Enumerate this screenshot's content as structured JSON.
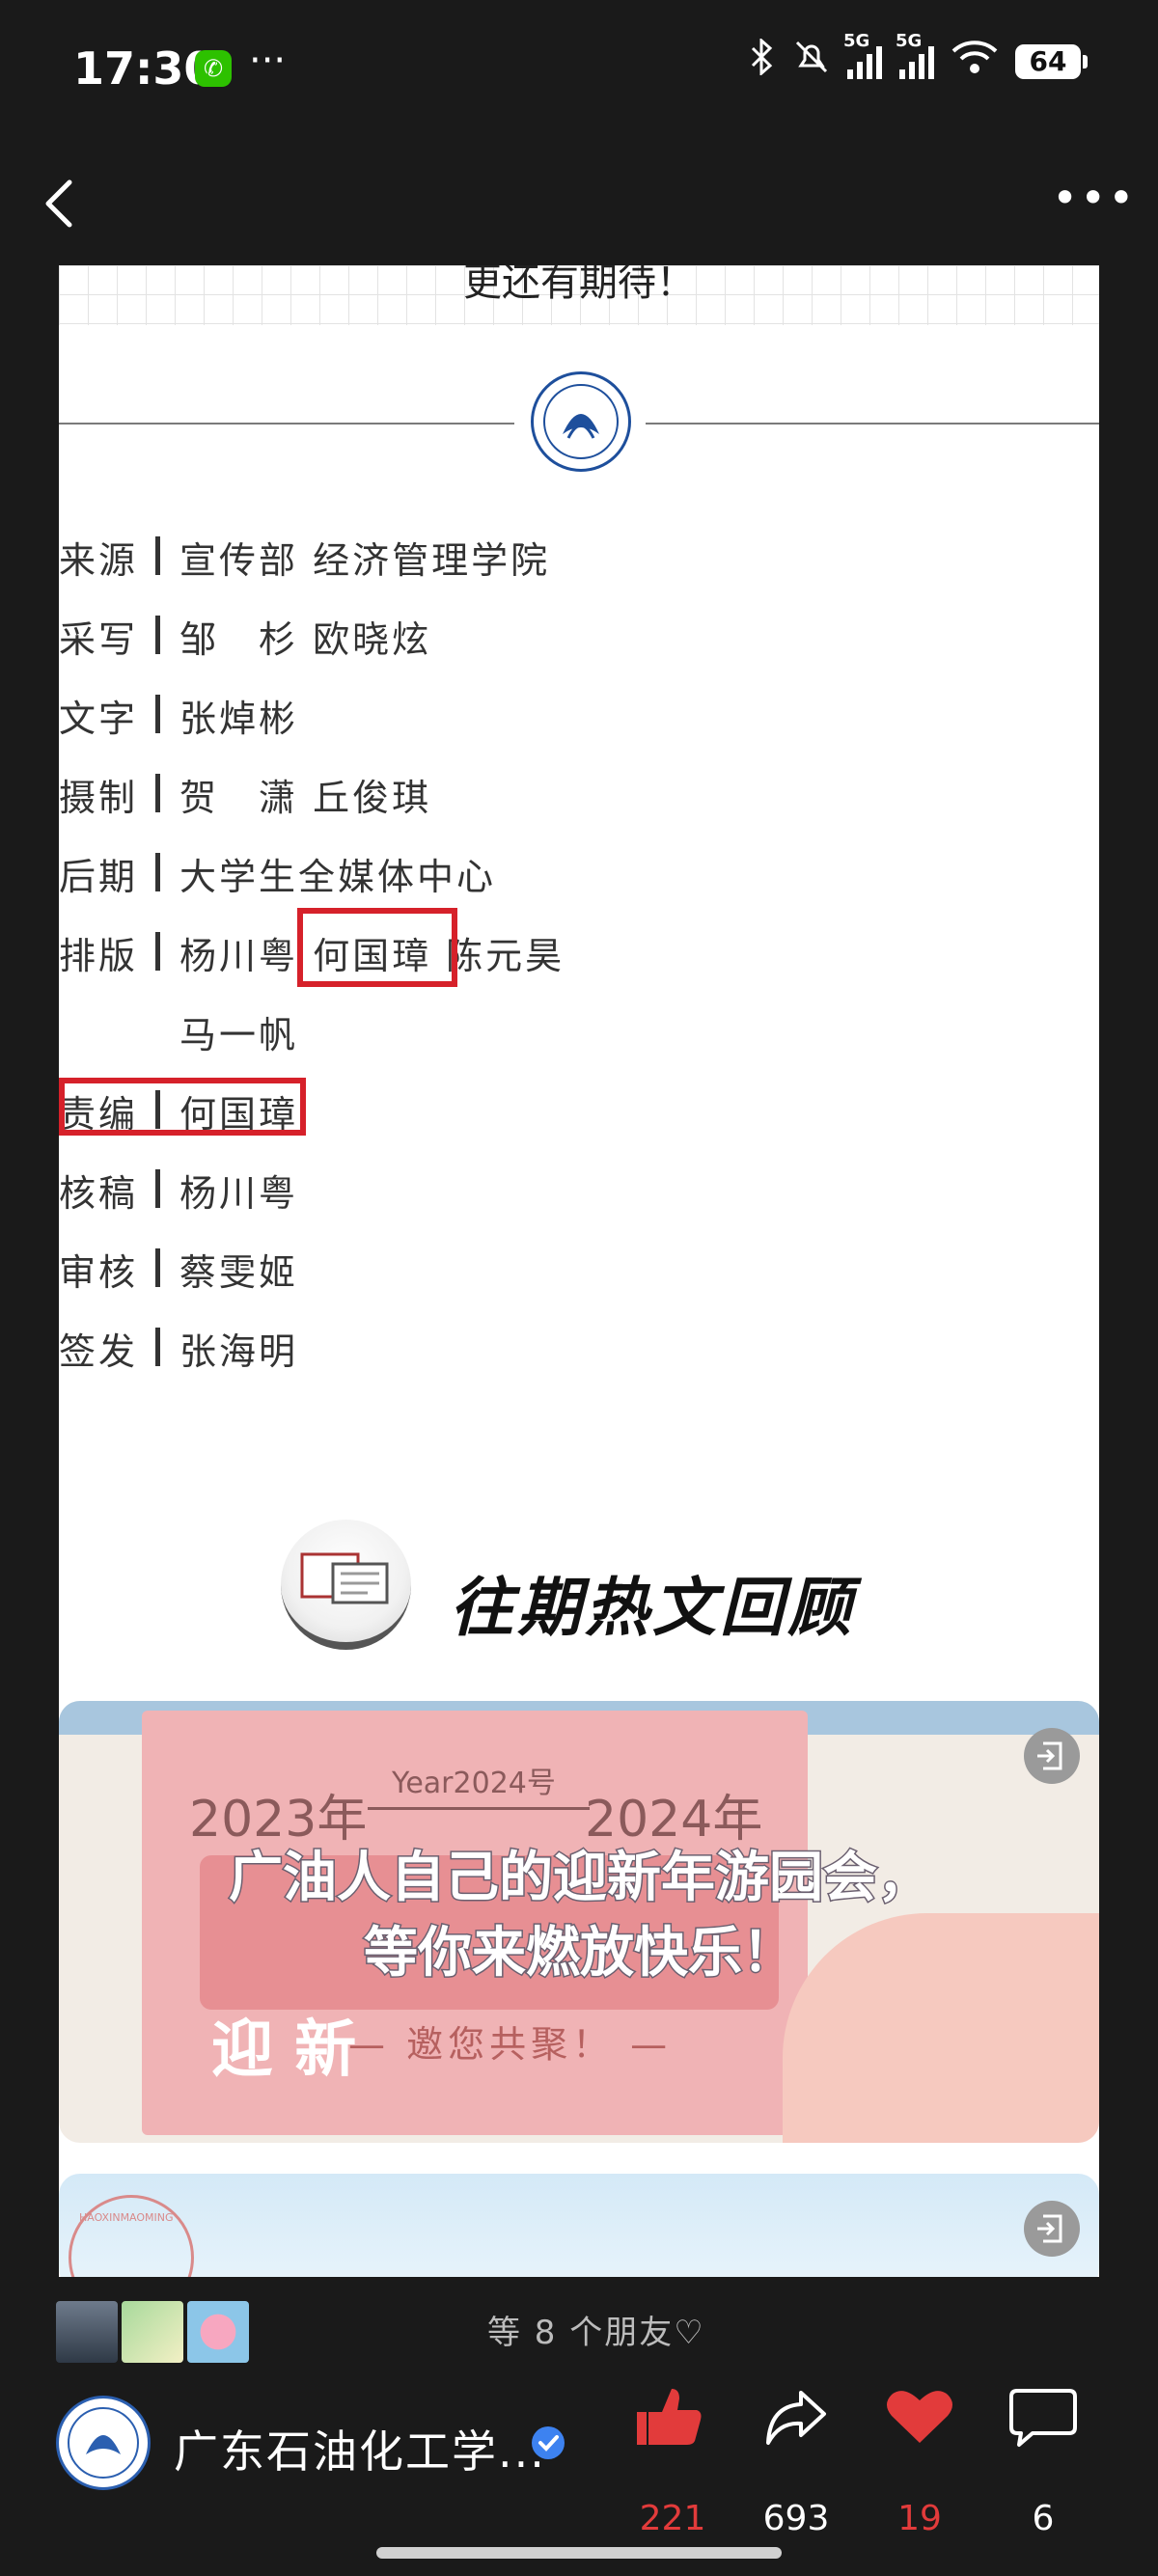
{
  "status_bar": {
    "time": "17:30",
    "more": "···",
    "net1": "5G",
    "net2": "5G",
    "battery": "64",
    "icons": [
      "wechat-icon",
      "bluetooth-icon",
      "mute-icon",
      "signal-icon",
      "wifi-icon",
      "battery-icon"
    ]
  },
  "nav": {
    "back_icon": "chevron-left-icon",
    "more_label": "•••"
  },
  "article": {
    "top_text": "更还有期待！",
    "credits": [
      {
        "key": "来源",
        "value": "宣传部 经济管理学院"
      },
      {
        "key": "采写",
        "value": "邹　杉 欧晓炫"
      },
      {
        "key": "文字",
        "value": "张焯彬"
      },
      {
        "key": "摄制",
        "value": "贺　潇 丘俊琪"
      },
      {
        "key": "后期",
        "value": "大学生全媒体中心"
      },
      {
        "key": "排版",
        "value": "杨川粤 何国璋 陈元昊"
      },
      {
        "key": "",
        "value": "马一帆"
      },
      {
        "key": "责编",
        "value": "何国璋"
      },
      {
        "key": "核稿",
        "value": "杨川粤"
      },
      {
        "key": "审核",
        "value": "蔡雯姬"
      },
      {
        "key": "签发",
        "value": "张海明"
      }
    ],
    "section_title": "往期热文回顾",
    "card1": {
      "year_left": "2023年",
      "year_mid": "Year2024号",
      "year_right": "2024年",
      "ying": "迎 新",
      "headline_line1": "广油人自己的迎新年游园会，",
      "headline_line2": "等你来燃放快乐！",
      "invite": "— 邀您共聚！ —"
    },
    "card2": {
      "seal_text": "HAOXINMAOMING"
    }
  },
  "bottom": {
    "friends": "等 8 个朋友♡",
    "account_name": "广东石油化工学...",
    "likes": "221",
    "shares": "693",
    "hearts": "19",
    "comments": "6"
  },
  "colors": {
    "accent_red": "#d6212a",
    "like_red": "#e23b3b",
    "bg_dark": "#1a1a1a",
    "verify_blue": "#3d82f0"
  }
}
